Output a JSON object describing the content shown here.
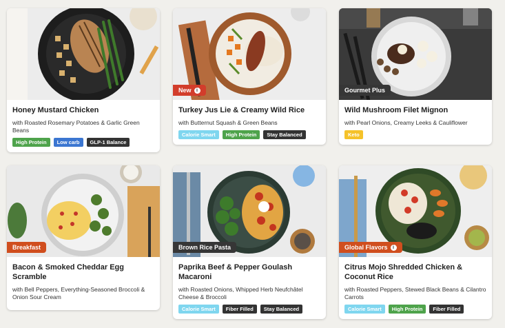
{
  "colors": {
    "high_protein": "#4ea34b",
    "low_carb": "#3b76d1",
    "dark": "#333333",
    "calorie_smart": "#7fd6ef",
    "keto": "#f5c22a",
    "tag_new": "#d23d2b",
    "tag_dark": "#363636",
    "tag_orange": "#d04e1e"
  },
  "cards": [
    {
      "title": "Honey Mustard Chicken",
      "subtitle": "with Roasted Rosemary Potatoes & Garlic Green Beans",
      "tag": "",
      "badges": [
        "High Protein",
        "Low carb",
        "GLP-1 Balance"
      ]
    },
    {
      "title": "Turkey Jus Lie & Creamy Wild Rice",
      "subtitle": "with Butternut Squash & Green Beans",
      "tag": "New",
      "badges": [
        "Calorie Smart",
        "High Protein",
        "Stay Balanced"
      ]
    },
    {
      "title": "Wild Mushroom Filet Mignon",
      "subtitle": "with Pearl Onions, Creamy Leeks & Cauliflower",
      "tag": "Gourmet Plus",
      "badges": [
        "Keto"
      ]
    },
    {
      "title": "Bacon & Smoked Cheddar Egg Scramble",
      "subtitle": "with Bell Peppers, Everything-Seasoned Broccoli & Onion Sour Cream",
      "tag": "Breakfast",
      "badges": []
    },
    {
      "title": "Paprika Beef & Pepper Goulash Macaroni",
      "subtitle": "with Roasted Onions, Whipped Herb Neufchâtel Cheese & Broccoli",
      "tag": "Brown Rice Pasta",
      "badges": [
        "Calorie Smart",
        "Fiber Filled",
        "Stay Balanced"
      ]
    },
    {
      "title": "Citrus Mojo Shredded Chicken & Coconut Rice",
      "subtitle": "with Roasted Peppers, Stewed Black Beans & Cilantro Carrots",
      "tag": "Global Flavors",
      "badges": [
        "Calorie Smart",
        "High Protein",
        "Fiber Filled"
      ]
    }
  ]
}
